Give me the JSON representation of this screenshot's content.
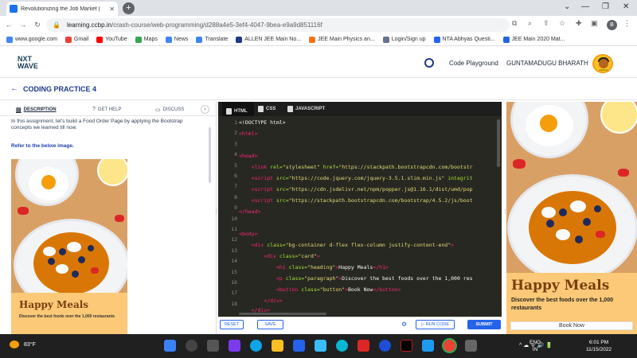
{
  "browser": {
    "tab_title": "Revolutionizing the Job Market |",
    "tab_close": "✕",
    "new_tab": "+",
    "url_domain": "learning.ccbp.in",
    "url_path": "/crash-course/web-programming/d288a4e5-3ef4-4047-9bea-e9a9d851116f",
    "profile_initial": "B",
    "bookmarks": [
      {
        "label": "www.google.com",
        "color": "#4285f4"
      },
      {
        "label": "Gmail",
        "color": "#ea4335"
      },
      {
        "label": "YouTube",
        "color": "#ff0000"
      },
      {
        "label": "Maps",
        "color": "#34a853"
      },
      {
        "label": "News",
        "color": "#4285f4"
      },
      {
        "label": "Translate",
        "color": "#4285f4"
      },
      {
        "label": "ALLEN JEE Main No...",
        "color": "#1e3a8a"
      },
      {
        "label": "JEE Main Physics an...",
        "color": "#f97316"
      },
      {
        "label": "Login/Sign up",
        "color": "#64748b"
      },
      {
        "label": "NTA Abhyas Questi...",
        "color": "#2563eb"
      },
      {
        "label": "JEE Main 2020 Mat...",
        "color": "#2563eb"
      }
    ]
  },
  "header": {
    "logo_top": "NXT",
    "logo_bottom": "WAVE",
    "playground": "Code Playground",
    "username": "GUNTAMADUGU BHARATH",
    "avatar_badge": "GENIUS"
  },
  "page": {
    "back": "←",
    "title": "CODING PRACTICE 4"
  },
  "left_tabs": {
    "description": "DESCRIPTION",
    "get_help": "GET HELP",
    "discuss": "DISCUSS",
    "collapse": "‹"
  },
  "description": {
    "intro": "In this assignment, let's build a Food Order Page by applying the Bootstrap concepts we learned till now.",
    "refer": "Refer to the below image."
  },
  "preview": {
    "heading": "Happy Meals",
    "paragraph": "Discover the best foods over the 1,000 restaurants",
    "button": "Book Now"
  },
  "editor": {
    "tabs": [
      "HTML",
      "CSS",
      "JAVASCRIPT"
    ],
    "line_numbers": [
      "1",
      "2",
      "3",
      "4",
      "5",
      "6",
      "7",
      "8",
      "9",
      "10",
      "11",
      "12",
      "13",
      "14",
      "15",
      "16",
      "17",
      "18"
    ],
    "reset": "RESET",
    "save": "SAVE",
    "run_code": "▷ RUN CODE",
    "submit": "SUBMIT"
  },
  "taskbar": {
    "temp": "83°F",
    "lang1": "ENG",
    "lang2": "IN",
    "time": "6:01 PM",
    "date": "11/15/2022",
    "sys_icons": "^ ☁ ᯤ 🔊 🔋"
  }
}
